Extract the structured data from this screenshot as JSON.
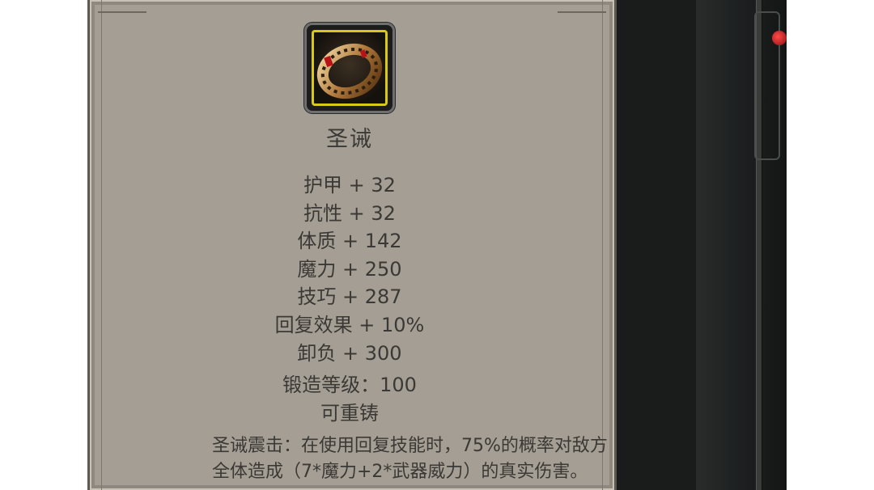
{
  "item": {
    "name": "圣诫",
    "icon": "ring-icon",
    "stats": [
      "护甲 + 32",
      "抗性 + 32",
      "体质 + 142",
      "魔力 + 250",
      "技巧 + 287",
      "回复效果 + 10%",
      "卸负 + 300"
    ],
    "forge_level": "锻造等级：100",
    "recast": "可重铸",
    "skill_line1": "圣诫震击：在使用回复技能时，75%的概率对敌方",
    "skill_line2": "全体造成（7*魔力+2*武器威力）的真实伤害。"
  },
  "colors": {
    "panel": "#a59e94",
    "text": "#3a3935",
    "icon_border": "#d8c818"
  }
}
